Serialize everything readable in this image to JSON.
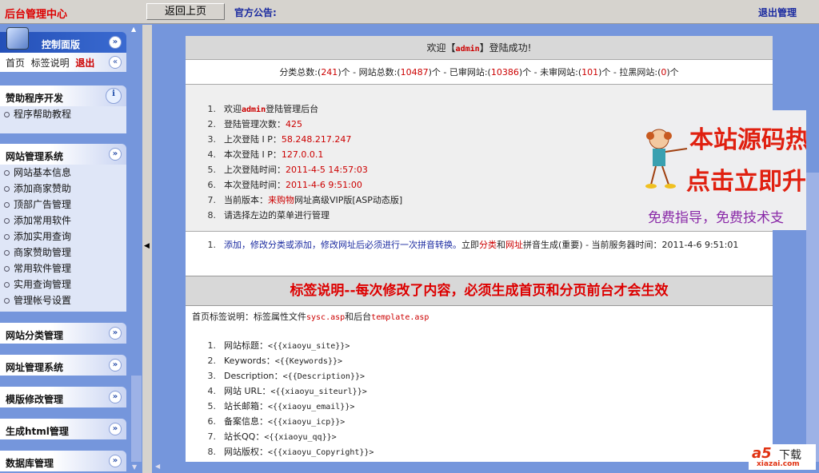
{
  "topbar": {
    "brand": "后台管理中心",
    "back_button": "返回上页",
    "notice_label": "官方公告:",
    "logout": "退出管理"
  },
  "sidebar": {
    "control": {
      "title": "控制面版",
      "links": [
        "首页",
        "标签说明",
        "退出"
      ]
    },
    "sponsor": {
      "title": "赞助程序开发",
      "items": [
        "程序帮助教程"
      ]
    },
    "site_mgmt": {
      "title": "网站管理系统",
      "items": [
        "网站基本信息",
        "添加商家赞助",
        "顶部广告管理",
        "添加常用软件",
        "添加实用查询",
        "商家赞助管理",
        "常用软件管理",
        "实用查询管理",
        "管理帐号设置"
      ]
    },
    "collapsed": [
      "网站分类管理",
      "网址管理系统",
      "模版修改管理",
      "生成html管理",
      "数据库管理"
    ]
  },
  "main": {
    "welcome": {
      "pre": "欢迎【",
      "user": "admin",
      "post": "】登陆成功!"
    },
    "stats": [
      {
        "label": "分类总数:(",
        "value": "241",
        "suffix": ")个 - "
      },
      {
        "label": "网站总数:(",
        "value": "10487",
        "suffix": ")个 - "
      },
      {
        "label": "已审网站:(",
        "value": "10386",
        "suffix": ")个 - "
      },
      {
        "label": "未审网站:(",
        "value": "101",
        "suffix": ")个 - "
      },
      {
        "label": "拉黑网站:(",
        "value": "0",
        "suffix": ")个"
      }
    ],
    "info": [
      {
        "n": "1.",
        "label": "欢迎",
        "value": "admin",
        "tail": "登陆管理后台"
      },
      {
        "n": "2.",
        "label": "登陆管理次数：",
        "value": "425",
        "tail": ""
      },
      {
        "n": "3.",
        "label": "上次登陆 I P：",
        "value": "58.248.217.247",
        "tail": ""
      },
      {
        "n": "4.",
        "label": "本次登陆 I P：",
        "value": "127.0.0.1",
        "tail": ""
      },
      {
        "n": "5.",
        "label": "上次登陆时间：",
        "value": "2011-4-5 14:57:03",
        "tail": ""
      },
      {
        "n": "6.",
        "label": "本次登陆时间：",
        "value": "2011-4-6 9:51:00",
        "tail": ""
      },
      {
        "n": "7.",
        "label": "当前版本：",
        "value": "来购物",
        "tail": "网址高级VIP版[ASP动态版]"
      },
      {
        "n": "8.",
        "label": "请选择左边的菜单进行管理",
        "value": "",
        "tail": ""
      }
    ],
    "tip": {
      "n": "1.",
      "blue": "添加，修改分类或添加，修改网址后必须进行一次拼音转换。",
      "a": "立即",
      "link1": "分类",
      "b": "和",
      "link2": "网址",
      "c": "拼音生成(重要) - 当前服务器时间：2011-4-6 9:51:01"
    },
    "tag_title": "标签说明--每次修改了内容，必须生成首页和分页前台才会生效",
    "tag_intro": {
      "a": "首页标签说明：标签属性文件",
      "f1": "sysc.asp",
      "b": "和后台",
      "f2": "template.asp"
    },
    "tags": [
      {
        "n": "1.",
        "label": "网站标题：",
        "code": "<{{xiaoyu_site}}>"
      },
      {
        "n": "2.",
        "label": "Keywords：",
        "code": "<{{Keywords}}>"
      },
      {
        "n": "3.",
        "label": "Description：",
        "code": "<{{Description}}>"
      },
      {
        "n": "4.",
        "label": "网站 URL：",
        "code": "<{{xiaoyu_siteurl}}>"
      },
      {
        "n": "5.",
        "label": "站长邮箱：",
        "code": "<{{xiaoyu_email}}>"
      },
      {
        "n": "6.",
        "label": "备案信息：",
        "code": "<{{xiaoyu_icp}}>"
      },
      {
        "n": "7.",
        "label": "站长QQ：",
        "code": "<{{xiaoyu_qq}}>"
      },
      {
        "n": "8.",
        "label": "网站版权：",
        "code": "<{{xiaoyu_Copyright}}>"
      }
    ]
  },
  "ad": {
    "line1": "本站源码热",
    "line2": "点击立即升",
    "line3": "免费指导，免费技术支"
  },
  "watermark": {
    "brand": "a5下载",
    "url": "xiazai.com"
  }
}
